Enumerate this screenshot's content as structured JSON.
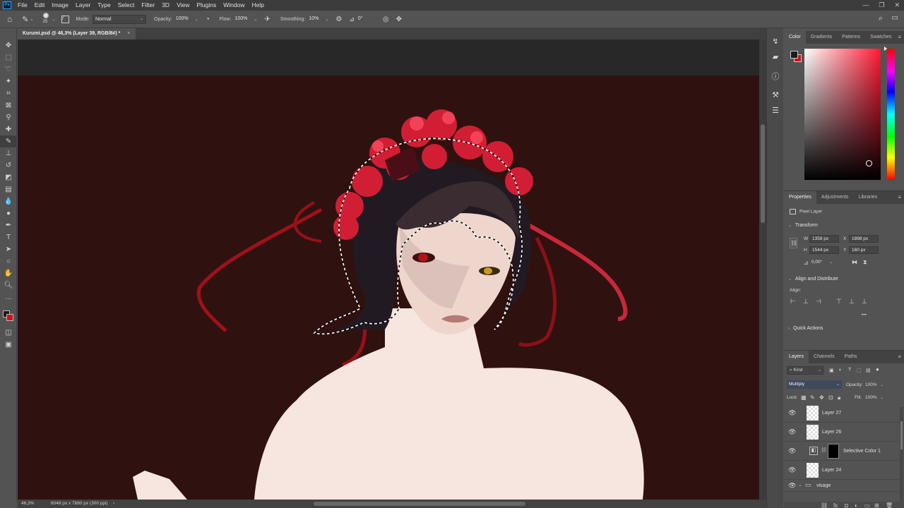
{
  "app": {
    "menu": [
      "File",
      "Edit",
      "Image",
      "Layer",
      "Type",
      "Select",
      "Filter",
      "3D",
      "View",
      "Plugins",
      "Window",
      "Help"
    ],
    "window_controls": [
      "—",
      "❐",
      "✕"
    ]
  },
  "options_bar": {
    "brush_size": "25",
    "mode_label": "Mode:",
    "mode_value": "Normal",
    "opacity_label": "Opacity:",
    "opacity_value": "100%",
    "flow_label": "Flow:",
    "flow_value": "100%",
    "smoothing_label": "Smoothing:",
    "smoothing_value": "10%",
    "angle_value": "0°"
  },
  "document": {
    "tab_title": "Kurumi.psd @ 46,3% (Layer 39, RGB/8#) *",
    "close": "×"
  },
  "status_bar": {
    "zoom": "46,3%",
    "dimensions": "6048 px x 7680 px (300 ppi)",
    "arrow": "›"
  },
  "color_panel": {
    "tabs": [
      "Color",
      "Gradients",
      "Patterns",
      "Swatches"
    ],
    "foreground": "#1c1c1c",
    "background": "#d40f17",
    "hue": "#ff1a34"
  },
  "properties_panel": {
    "tabs": [
      "Properties",
      "Adjustments",
      "Libraries"
    ],
    "kind": "Pixel Layer",
    "transform_title": "Transform",
    "w_label": "W",
    "w_value": "1358 px",
    "x_label": "X",
    "x_value": "1898 px",
    "h_label": "H",
    "h_value": "1544 px",
    "y_label": "Y",
    "y_value": "160 px",
    "angle_value": "0,00°",
    "align_title": "Align and Distribute",
    "align_label": "Align:",
    "more": "•••",
    "quick_actions_title": "Quick Actions"
  },
  "layers_panel": {
    "tabs": [
      "Layers",
      "Channels",
      "Paths"
    ],
    "filter_label": "Kind",
    "blend_mode": "Multiply",
    "opacity_label": "Opacity:",
    "opacity_value": "100%",
    "lock_label": "Lock:",
    "fill_label": "Fill:",
    "fill_value": "100%",
    "layers": [
      {
        "name": "Layer 27",
        "type": "pixel"
      },
      {
        "name": "Layer 26",
        "type": "pixel"
      },
      {
        "name": "Selective Color 1",
        "type": "adjustment"
      },
      {
        "name": "Layer 24",
        "type": "pixel"
      },
      {
        "name": "visage",
        "type": "group"
      }
    ]
  },
  "colors": {
    "canvas_bg": "#2f120f",
    "skin": "#f7e6e0",
    "accent_red": "#d40f17"
  }
}
